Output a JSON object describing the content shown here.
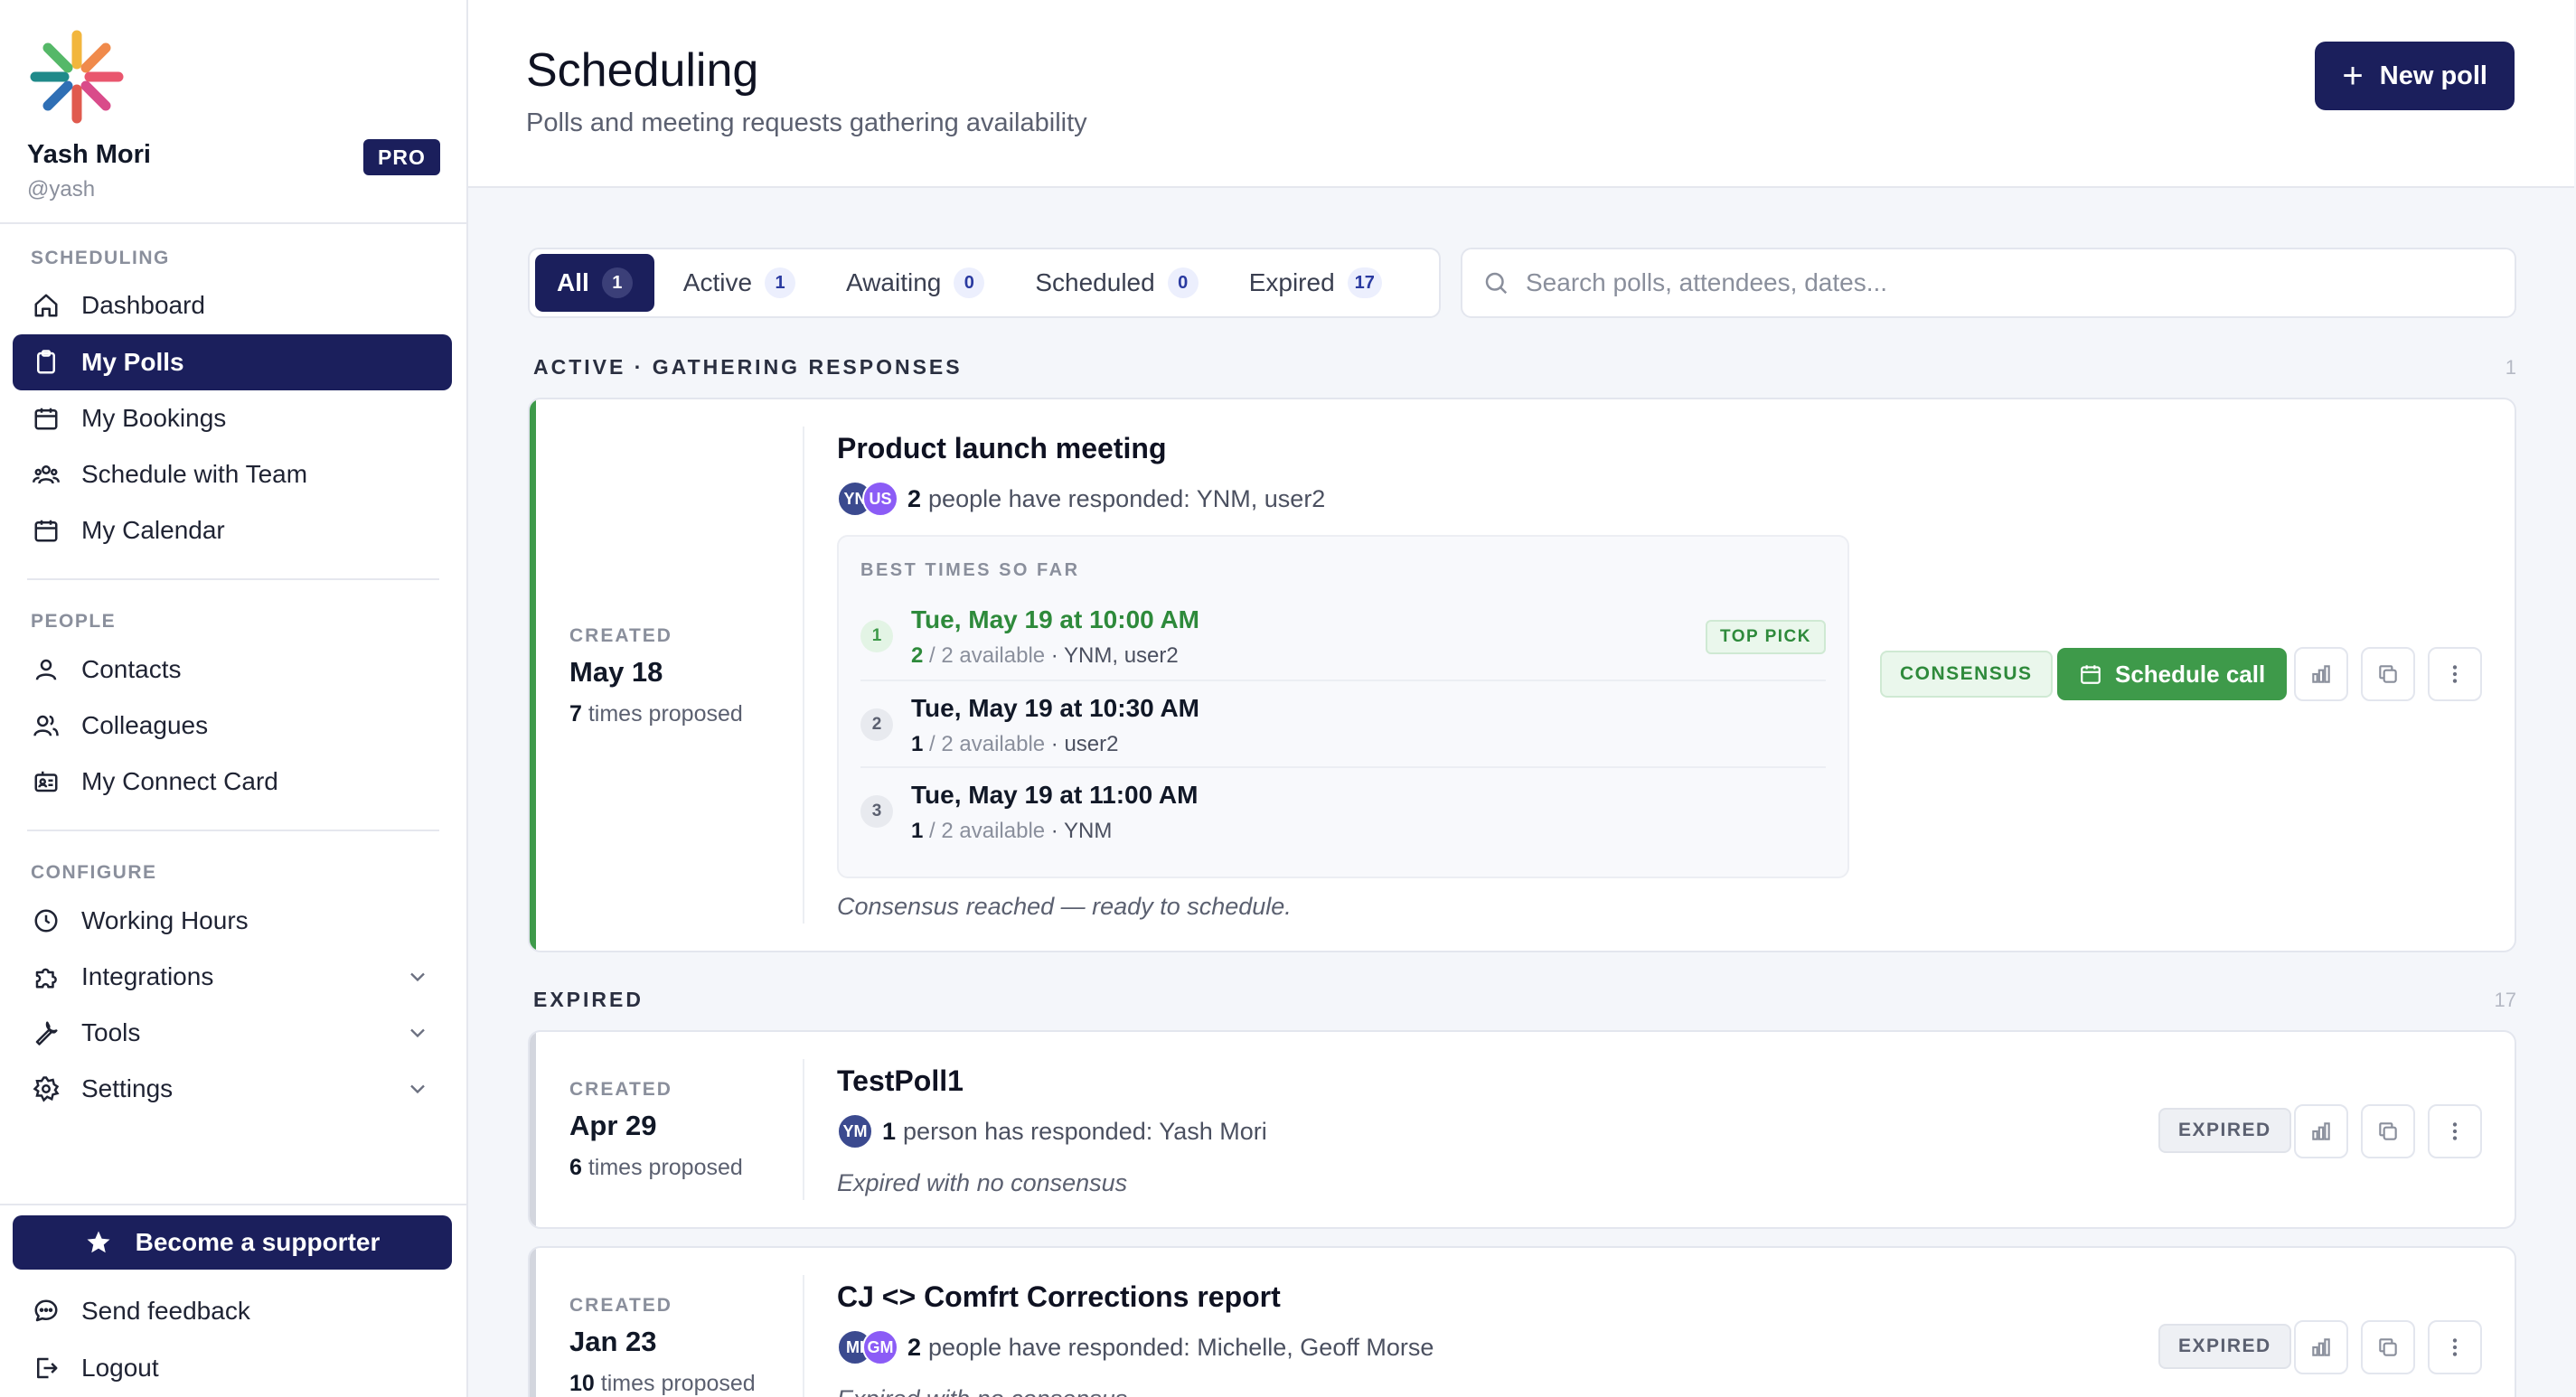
{
  "sidebar": {
    "user_name": "Yash Mori",
    "user_handle": "@yash",
    "plan_badge": "PRO",
    "sections": {
      "scheduling": "SCHEDULING",
      "people": "PEOPLE",
      "configure": "CONFIGURE"
    },
    "items": {
      "dashboard": "Dashboard",
      "my_polls": "My Polls",
      "my_bookings": "My Bookings",
      "schedule_with_team": "Schedule with Team",
      "my_calendar": "My Calendar",
      "contacts": "Contacts",
      "colleagues": "Colleagues",
      "my_connect_card": "My Connect Card",
      "working_hours": "Working Hours",
      "integrations": "Integrations",
      "tools": "Tools",
      "settings": "Settings"
    },
    "supporter_button": "Become a supporter",
    "send_feedback": "Send feedback",
    "logout": "Logout",
    "active_item": "my_polls",
    "accent_color": "#1b1f5c"
  },
  "header": {
    "title": "Scheduling",
    "subtitle": "Polls and meeting requests gathering availability",
    "new_poll_label": "New poll"
  },
  "filters": {
    "tabs": [
      {
        "label": "All",
        "count": "1"
      },
      {
        "label": "Active",
        "count": "1"
      },
      {
        "label": "Awaiting",
        "count": "0"
      },
      {
        "label": "Scheduled",
        "count": "0"
      },
      {
        "label": "Expired",
        "count": "17"
      }
    ],
    "active_tab": "All",
    "search_placeholder": "Search polls, attendees, dates..."
  },
  "active_section": {
    "label": "ACTIVE · GATHERING RESPONSES",
    "count": "1",
    "poll": {
      "created_label": "CREATED",
      "created_date": "May 18",
      "times_count": "7",
      "times_suffix": "times proposed",
      "title": "Product launch meeting",
      "avatars": [
        {
          "initials": "YN",
          "color": "#3b4a8f"
        },
        {
          "initials": "US",
          "color": "#8b5cf6"
        }
      ],
      "responded_count": "2",
      "responded_text": "people have responded: YNM, user2",
      "best_times_label": "BEST TIMES SO FAR",
      "slots": [
        {
          "rank": "1",
          "when": "Tue, May 19 at 10:00 AM",
          "available": "2",
          "total": "/ 2 available",
          "names": "· YNM, user2",
          "top_pick": "TOP PICK"
        },
        {
          "rank": "2",
          "when": "Tue, May 19 at 10:30 AM",
          "available": "1",
          "total": "/ 2 available",
          "names": "· user2"
        },
        {
          "rank": "3",
          "when": "Tue, May 19 at 11:00 AM",
          "available": "1",
          "total": "/ 2 available",
          "names": "· YNM"
        }
      ],
      "note": "Consensus reached — ready to schedule.",
      "badge": "CONSENSUS",
      "schedule_button": "Schedule call",
      "accent_color": "#3e9a4a"
    }
  },
  "expired_section": {
    "label": "EXPIRED",
    "count": "17",
    "polls": [
      {
        "created_label": "CREATED",
        "created_date": "Apr 29",
        "times_count": "6",
        "times_suffix": "times proposed",
        "title": "TestPoll1",
        "avatars": [
          {
            "initials": "YM",
            "color": "#3b4a8f"
          }
        ],
        "responded_count": "1",
        "responded_text": "person has responded: Yash Mori",
        "note": "Expired with no consensus",
        "badge": "EXPIRED"
      },
      {
        "created_label": "CREATED",
        "created_date": "Jan 23",
        "times_count": "10",
        "times_suffix": "times proposed",
        "title": "CJ <> Comfrt Corrections report",
        "avatars": [
          {
            "initials": "MI",
            "color": "#3b4a8f"
          },
          {
            "initials": "GM",
            "color": "#8b5cf6"
          }
        ],
        "responded_count": "2",
        "responded_text": "people have responded: Michelle, Geoff Morse",
        "note": "Expired with no consensus",
        "badge": "EXPIRED"
      }
    ]
  }
}
